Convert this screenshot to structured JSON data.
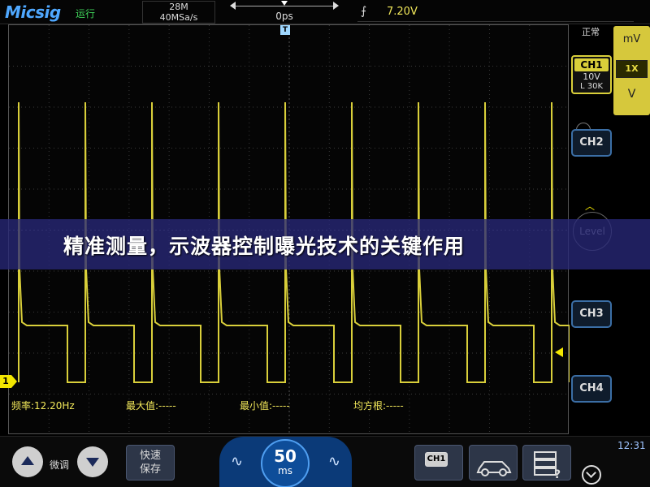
{
  "app": {
    "brand": "Micsig",
    "run_state": "运行"
  },
  "acquisition": {
    "memory_depth": "28M",
    "sample_rate": "40MSa/s"
  },
  "horizontal": {
    "position": "0ps"
  },
  "trigger": {
    "slope_icon": "rising-edge-icon",
    "level_value": "7.20V"
  },
  "channel_panel": {
    "mode": "正常",
    "ch1_name": "CH1",
    "ch1_volts_div": "10V",
    "ch1_coupling": "L 30K",
    "mv_label": "mV",
    "probe_ratio": "1X",
    "v_label": "V",
    "ch2_label": "CH2",
    "ch3_label": "CH3",
    "ch4_label": "CH4",
    "level_label": "Level"
  },
  "measurements": {
    "frequency": "频率:12.20Hz",
    "maximum": "最大值:-----",
    "minimum": "最小值:-----",
    "rms": "均方根:-----"
  },
  "grid_marker": {
    "channel": "1",
    "trigger_tag": "T"
  },
  "banner": {
    "text": "精准测量，示波器控制曝光技术的关键作用"
  },
  "bottom": {
    "fine_adjust_label": "微调",
    "quick_save_label": "快速\n保存",
    "timebase_value": "50",
    "timebase_unit": "ms",
    "tool_ch1_label": "CH1",
    "clock": "12:31"
  },
  "colors": {
    "ch1_trace": "#d9cf3a",
    "grid_line": "#3a3a3a",
    "banner_bg": "#282878",
    "panel_yellow": "#d6c83c",
    "timebase_blue": "#0b3a78"
  }
}
